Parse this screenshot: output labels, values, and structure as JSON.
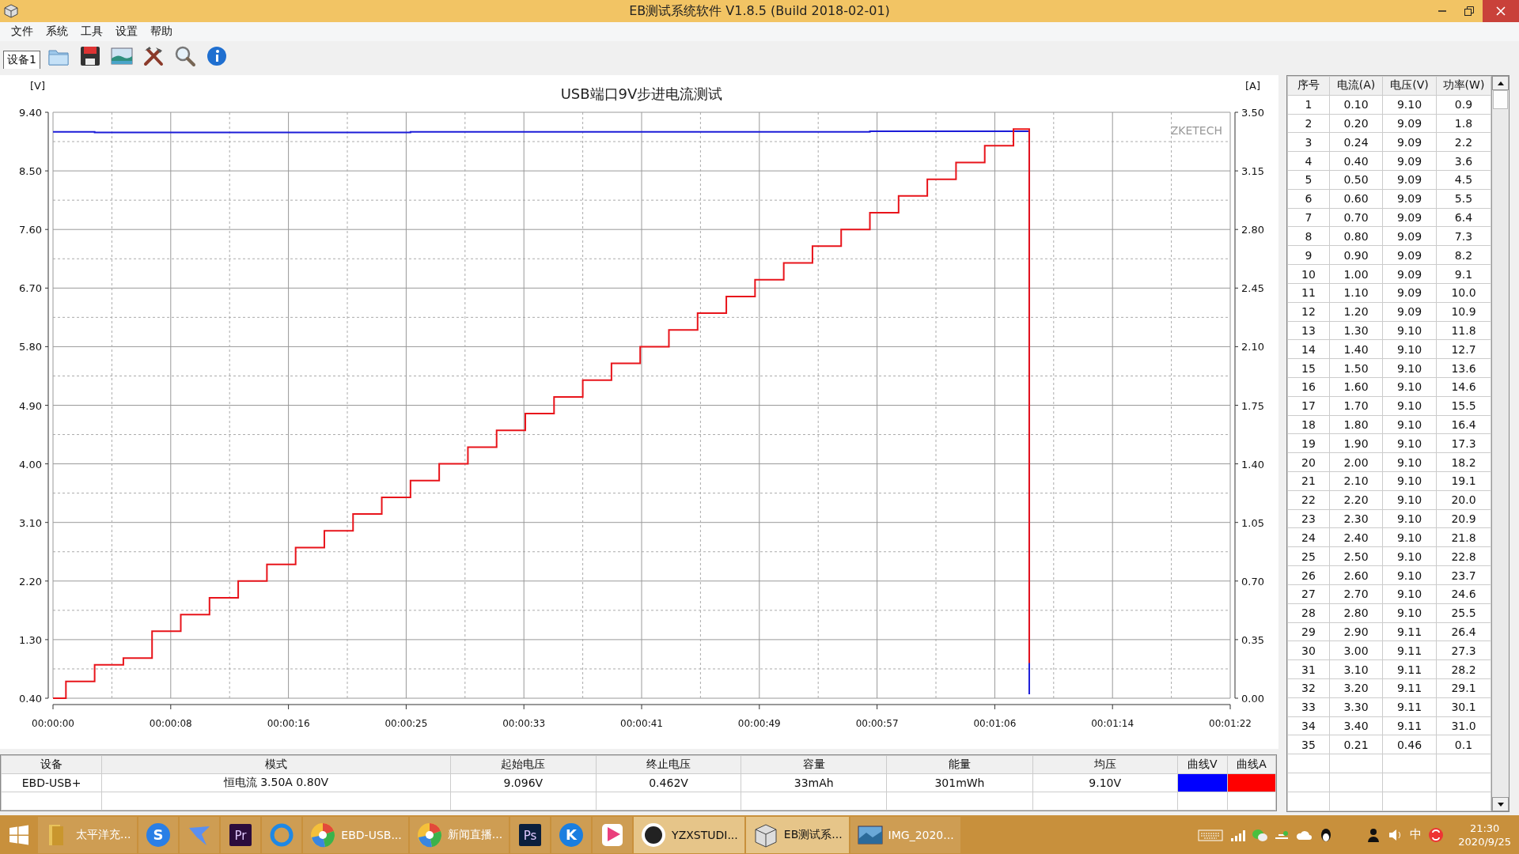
{
  "window": {
    "title": "EB测试系统软件 V1.8.5 (Build 2018-02-01)"
  },
  "menu": [
    "文件",
    "系统",
    "工具",
    "设置",
    "帮助"
  ],
  "toolbar": {
    "tabs": [
      {
        "label": "设备1",
        "selected": true
      }
    ],
    "tools": [
      {
        "kind": "folder"
      },
      {
        "kind": "save"
      },
      {
        "kind": "picture"
      },
      {
        "kind": "tools"
      },
      {
        "kind": "search"
      },
      {
        "kind": "info"
      }
    ]
  },
  "chart": {
    "brand_label": "ZKETECH",
    "right_unit": "[A]",
    "chart_data": {
      "type": "line",
      "title": "USB端口9V步进电流测试",
      "ylabel": "[V]",
      "grid": true,
      "xlim": [
        0,
        82
      ],
      "ylim": [
        0.4,
        9.4
      ],
      "y2lim": [
        0,
        3.5
      ],
      "y2ticks": [
        {
          "value": 0,
          "label": "0.00"
        },
        {
          "value": 0.35,
          "label": "0.35"
        },
        {
          "value": 0.7,
          "label": "0.70"
        },
        {
          "value": 1.05,
          "label": "1.05"
        },
        {
          "value": 1.4,
          "label": "1.40"
        },
        {
          "value": 1.75,
          "label": "1.75"
        },
        {
          "value": 2.1,
          "label": "2.10"
        },
        {
          "value": 2.45,
          "label": "2.45"
        },
        {
          "value": 2.8,
          "label": "2.80"
        },
        {
          "value": 3.15,
          "label": "3.15"
        },
        {
          "value": 3.5,
          "label": "3.50"
        }
      ],
      "xticks": [
        {
          "value": 0,
          "label": "00:00:00"
        },
        {
          "value": 8.2,
          "label": "00:00:08"
        },
        {
          "value": 16.4,
          "label": "00:00:16"
        },
        {
          "value": 24.6,
          "label": "00:00:25"
        },
        {
          "value": 32.8,
          "label": "00:00:33"
        },
        {
          "value": 41,
          "label": "00:00:41"
        },
        {
          "value": 49.2,
          "label": "00:00:49"
        },
        {
          "value": 57.4,
          "label": "00:00:57"
        },
        {
          "value": 65.6,
          "label": "00:01:06"
        },
        {
          "value": 73.8,
          "label": "00:01:14"
        },
        {
          "value": 82,
          "label": "00:01:22"
        }
      ],
      "yticks": [
        {
          "value": 0.4,
          "label": "0.40"
        },
        {
          "value": 1.3,
          "label": "1.30"
        },
        {
          "value": 2.2,
          "label": "2.20"
        },
        {
          "value": 3.1,
          "label": "3.10"
        },
        {
          "value": 4,
          "label": "4.00"
        },
        {
          "value": 4.9,
          "label": "4.90"
        },
        {
          "value": 5.8,
          "label": "5.80"
        },
        {
          "value": 6.7,
          "label": "6.70"
        },
        {
          "value": 7.6,
          "label": "7.60"
        },
        {
          "value": 8.5,
          "label": "8.50"
        },
        {
          "value": 9.4,
          "label": "9.40"
        }
      ],
      "x": [
        0,
        0.9,
        0.9,
        2.9,
        2.9,
        4.9,
        4.9,
        6.9,
        6.9,
        8.9,
        8.9,
        10.9,
        10.9,
        12.9,
        12.9,
        14.9,
        14.9,
        16.9,
        16.9,
        18.9,
        18.9,
        20.9,
        20.9,
        22.9,
        22.9,
        24.9,
        24.9,
        26.9,
        26.9,
        28.9,
        28.9,
        30.9,
        30.9,
        32.9,
        32.9,
        34.9,
        34.9,
        36.9,
        36.9,
        38.9,
        38.9,
        40.9,
        40.9,
        42.9,
        42.9,
        44.9,
        44.9,
        46.9,
        46.9,
        48.9,
        48.9,
        50.9,
        50.9,
        52.9,
        52.9,
        54.9,
        54.9,
        56.9,
        56.9,
        58.9,
        58.9,
        60.9,
        60.9,
        62.9,
        62.9,
        64.9,
        64.9,
        66.9,
        66.9,
        68,
        68
      ],
      "series": [
        {
          "color": "#1c1cd8",
          "values": [
            9.1,
            9.1,
            9.1,
            9.1,
            9.09,
            9.09,
            9.09,
            9.09,
            9.09,
            9.09,
            9.09,
            9.09,
            9.09,
            9.09,
            9.09,
            9.09,
            9.09,
            9.09,
            9.09,
            9.09,
            9.09,
            9.09,
            9.09,
            9.09,
            9.09,
            9.09,
            9.1,
            9.1,
            9.1,
            9.1,
            9.1,
            9.1,
            9.1,
            9.1,
            9.1,
            9.1,
            9.1,
            9.1,
            9.1,
            9.1,
            9.1,
            9.1,
            9.1,
            9.1,
            9.1,
            9.1,
            9.1,
            9.1,
            9.1,
            9.1,
            9.1,
            9.1,
            9.1,
            9.1,
            9.1,
            9.1,
            9.1,
            9.1,
            9.11,
            9.11,
            9.11,
            9.11,
            9.11,
            9.11,
            9.11,
            9.11,
            9.11,
            9.11,
            9.11,
            9.11,
            0.46
          ]
        },
        {
          "color": "#e8141b",
          "axis": "y2",
          "values": [
            0,
            0,
            0.1,
            0.1,
            0.2,
            0.2,
            0.24,
            0.24,
            0.4,
            0.4,
            0.5,
            0.5,
            0.6,
            0.6,
            0.7,
            0.7,
            0.8,
            0.8,
            0.9,
            0.9,
            1.0,
            1.0,
            1.1,
            1.1,
            1.2,
            1.2,
            1.3,
            1.3,
            1.4,
            1.4,
            1.5,
            1.5,
            1.6,
            1.6,
            1.7,
            1.7,
            1.8,
            1.8,
            1.9,
            1.9,
            2.0,
            2.0,
            2.1,
            2.1,
            2.2,
            2.2,
            2.3,
            2.3,
            2.4,
            2.4,
            2.5,
            2.5,
            2.6,
            2.6,
            2.7,
            2.7,
            2.8,
            2.8,
            2.9,
            2.9,
            3.0,
            3.0,
            3.1,
            3.1,
            3.2,
            3.2,
            3.3,
            3.3,
            3.4,
            3.4,
            0.21
          ]
        }
      ]
    }
  },
  "summary": {
    "columns": [
      "设备",
      "模式",
      "起始电压",
      "终止电压",
      "容量",
      "能量",
      "均压",
      "曲线V",
      "曲线A"
    ],
    "rows": [
      {
        "cells": [
          "EBD-USB+",
          "恒电流  3.50A  0.80V",
          "9.096V",
          "0.462V",
          "33mAh",
          "301mWh",
          "9.10V"
        ],
        "swatches": [
          {
            "color": "#0000ff"
          },
          {
            "color": "#ff0000"
          }
        ]
      }
    ]
  },
  "readings": {
    "columns": [
      "序号",
      "电流(A)",
      "电压(V)",
      "功率(W)"
    ],
    "rows": [
      [
        "1",
        "0.10",
        "9.10",
        "0.9"
      ],
      [
        "2",
        "0.20",
        "9.09",
        "1.8"
      ],
      [
        "3",
        "0.24",
        "9.09",
        "2.2"
      ],
      [
        "4",
        "0.40",
        "9.09",
        "3.6"
      ],
      [
        "5",
        "0.50",
        "9.09",
        "4.5"
      ],
      [
        "6",
        "0.60",
        "9.09",
        "5.5"
      ],
      [
        "7",
        "0.70",
        "9.09",
        "6.4"
      ],
      [
        "8",
        "0.80",
        "9.09",
        "7.3"
      ],
      [
        "9",
        "0.90",
        "9.09",
        "8.2"
      ],
      [
        "10",
        "1.00",
        "9.09",
        "9.1"
      ],
      [
        "11",
        "1.10",
        "9.09",
        "10.0"
      ],
      [
        "12",
        "1.20",
        "9.09",
        "10.9"
      ],
      [
        "13",
        "1.30",
        "9.10",
        "11.8"
      ],
      [
        "14",
        "1.40",
        "9.10",
        "12.7"
      ],
      [
        "15",
        "1.50",
        "9.10",
        "13.6"
      ],
      [
        "16",
        "1.60",
        "9.10",
        "14.6"
      ],
      [
        "17",
        "1.70",
        "9.10",
        "15.5"
      ],
      [
        "18",
        "1.80",
        "9.10",
        "16.4"
      ],
      [
        "19",
        "1.90",
        "9.10",
        "17.3"
      ],
      [
        "20",
        "2.00",
        "9.10",
        "18.2"
      ],
      [
        "21",
        "2.10",
        "9.10",
        "19.1"
      ],
      [
        "22",
        "2.20",
        "9.10",
        "20.0"
      ],
      [
        "23",
        "2.30",
        "9.10",
        "20.9"
      ],
      [
        "24",
        "2.40",
        "9.10",
        "21.8"
      ],
      [
        "25",
        "2.50",
        "9.10",
        "22.8"
      ],
      [
        "26",
        "2.60",
        "9.10",
        "23.7"
      ],
      [
        "27",
        "2.70",
        "9.10",
        "24.6"
      ],
      [
        "28",
        "2.80",
        "9.10",
        "25.5"
      ],
      [
        "29",
        "2.90",
        "9.11",
        "26.4"
      ],
      [
        "30",
        "3.00",
        "9.11",
        "27.3"
      ],
      [
        "31",
        "3.10",
        "9.11",
        "28.2"
      ],
      [
        "32",
        "3.20",
        "9.11",
        "29.1"
      ],
      [
        "33",
        "3.30",
        "9.11",
        "30.1"
      ],
      [
        "34",
        "3.40",
        "9.11",
        "31.0"
      ],
      [
        "35",
        "0.21",
        "0.46",
        "0.1"
      ]
    ]
  },
  "taskbar": {
    "items": [
      {
        "kind": "folder",
        "label": "太平洋充...",
        "highlighted": false
      },
      {
        "kind": "disc",
        "glyph": "S",
        "color": "#2a7fe6",
        "highlighted": false
      },
      {
        "kind": "bird",
        "color": "#5b8ff0",
        "highlighted": false
      },
      {
        "kind": "tile",
        "glyph": "Pr",
        "color": "#2b0c3d",
        "highlighted": false
      },
      {
        "kind": "ring",
        "color": "#1e88e5",
        "highlighted": false
      },
      {
        "kind": "pinwheel",
        "label": "EBD-USB...",
        "highlighted": false
      },
      {
        "kind": "pinwheel",
        "label": "新闻直播...",
        "highlighted": false
      },
      {
        "kind": "tile",
        "glyph": "Ps",
        "color": "#0b1f3d",
        "highlighted": false
      },
      {
        "kind": "disc",
        "glyph": "K",
        "color": "#1a7ee0",
        "highlighted": false
      },
      {
        "kind": "play",
        "color": "#ea3f7c",
        "highlighted": false
      },
      {
        "kind": "zdisc",
        "label": "YZXSTUDI...",
        "highlighted": true
      },
      {
        "kind": "box",
        "label": "EB测试系...",
        "highlighted": true
      },
      {
        "kind": "photo",
        "label": "IMG_2020...",
        "highlighted": false
      }
    ],
    "tray": {
      "ime": "中",
      "time": "21:30",
      "date": "2020/9/25"
    }
  }
}
